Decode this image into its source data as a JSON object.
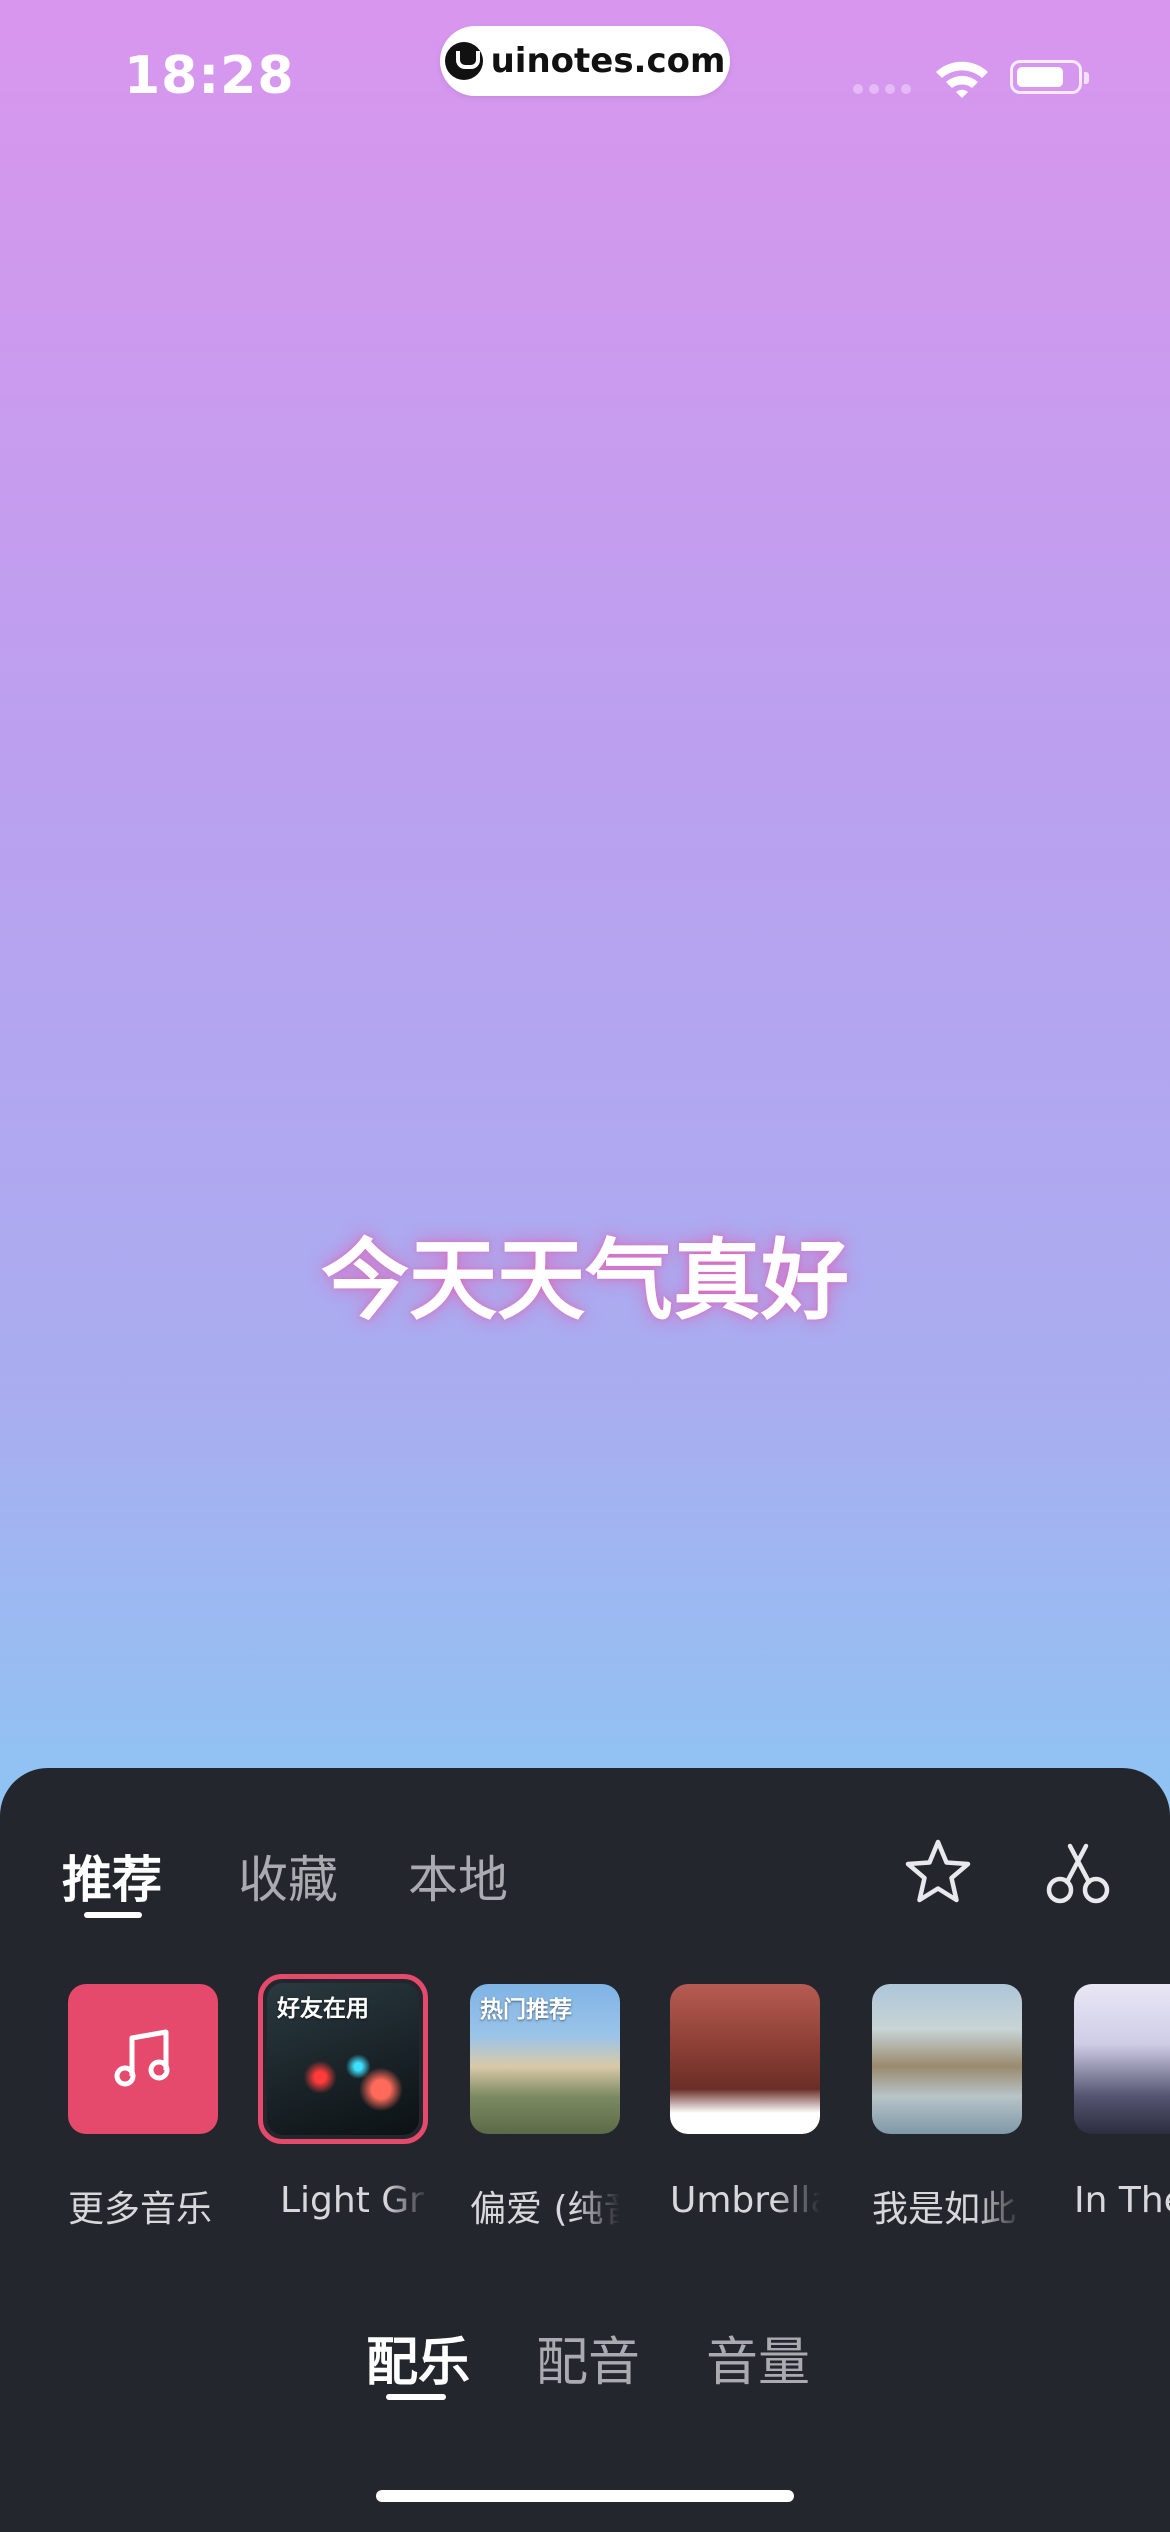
{
  "status_bar": {
    "time": "18:28",
    "watermark": "uinotes.com",
    "icons": [
      "cellular-signal-icon",
      "wifi-icon",
      "battery-icon"
    ]
  },
  "canvas": {
    "caption": "今天天气真好"
  },
  "panel": {
    "tabs": [
      {
        "label": "推荐",
        "active": true
      },
      {
        "label": "收藏",
        "active": false
      },
      {
        "label": "本地",
        "active": false
      }
    ],
    "action_icons": [
      "star-icon",
      "scissors-icon"
    ],
    "music_tiles": [
      {
        "label": "更多音乐",
        "icon": "music-note-icon"
      },
      {
        "label": "Light Gr",
        "badge": "好友在用",
        "selected": true
      },
      {
        "label": "偏爱 (纯音",
        "badge": "热门推荐"
      },
      {
        "label": "Umbrella"
      },
      {
        "label": "我是如此"
      },
      {
        "label": "In The"
      }
    ],
    "bottom_tabs": [
      {
        "label": "配乐",
        "active": true
      },
      {
        "label": "配音",
        "active": false
      },
      {
        "label": "音量",
        "active": false
      }
    ]
  },
  "colors": {
    "accent": "#e5496b",
    "panel_bg": "#23262c"
  }
}
